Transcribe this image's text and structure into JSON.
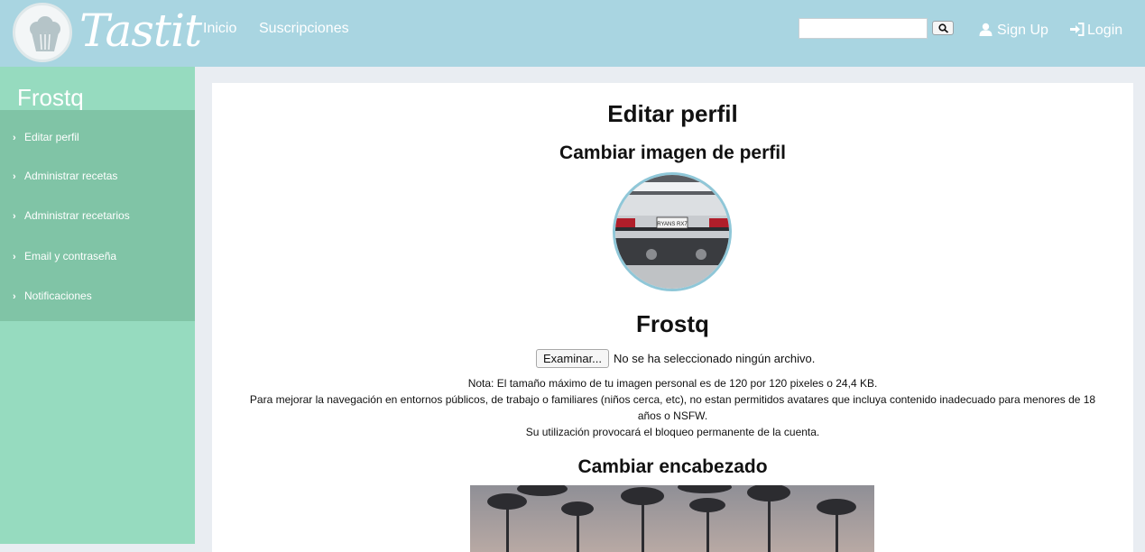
{
  "brand": {
    "name": "Tastit"
  },
  "nav": {
    "links": [
      "Inicio",
      "Suscripciones"
    ],
    "search_value": "",
    "signup": "Sign Up",
    "login": "Login"
  },
  "sidebar": {
    "title": "Frostq",
    "items": [
      "Editar perfil",
      "Administrar recetas",
      "Administrar recetarios",
      "Email y contraseña",
      "Notificaciones"
    ]
  },
  "main": {
    "title": "Editar perfil",
    "avatar_section": "Cambiar imagen de perfil",
    "username": "Frostq",
    "file_button": "Examinar...",
    "file_status": "No se ha seleccionado ningún archivo.",
    "note_lines": [
      "Nota: El tamaño máximo de tu imagen personal es de 120 por 120 pixeles o 24,4 KB.",
      "Para mejorar la navegación en entornos públicos, de trabajo o familiares (niños cerca, etc), no estan permitidos avatares que incluya contenido inadecuado para menores de 18",
      "años o NSFW.",
      "Su utilización provocará el bloqueo permanente de la cuenta."
    ],
    "header_section": "Cambiar encabezado",
    "license_plate": "RYANS RX7"
  },
  "colors": {
    "navbar": "#a9d5e1",
    "sidebar": "#96dbbf",
    "sidebar_menu": "#80c4a6",
    "avatar_border": "#8fc7d8"
  },
  "icons": [
    "cupcake-icon",
    "search-icon",
    "user-icon",
    "login-icon",
    "chevron-right-icon"
  ]
}
